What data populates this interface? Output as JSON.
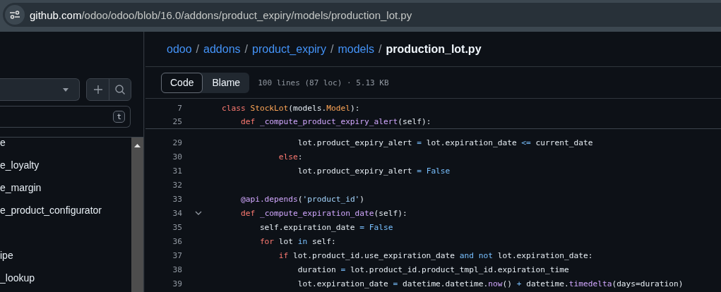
{
  "address_bar": {
    "host": "github.com",
    "path": "/odoo/odoo/blob/16.0/addons/product_expiry/models/production_lot.py"
  },
  "sidebar": {
    "filter_key": "t",
    "items": [
      {
        "label": "e"
      },
      {
        "label": "e_loyalty"
      },
      {
        "label": "e_margin"
      },
      {
        "label": "e_product_configurator"
      },
      {
        "label": "ipe",
        "gap_before": true
      },
      {
        "label": "_lookup"
      }
    ]
  },
  "breadcrumb": {
    "parts": [
      {
        "label": "odoo",
        "separator": "/"
      },
      {
        "label": "addons",
        "separator": "/"
      },
      {
        "label": "product_expiry",
        "separator": "/"
      },
      {
        "label": "models",
        "separator": "/"
      }
    ],
    "current": "production_lot.py"
  },
  "tabs": [
    {
      "label": "Code",
      "selected": true
    },
    {
      "label": "Blame",
      "selected": false
    }
  ],
  "file_info": "100 lines (87 loc) · 5.13 KB",
  "sticky_lines": [
    {
      "number": "7",
      "tokens": [
        {
          "kind": "kw",
          "text": "class"
        },
        {
          "kind": "cls",
          "text": " StockLot"
        },
        {
          "kind": "plain",
          "text": "(models."
        },
        {
          "kind": "cls",
          "text": "Model"
        },
        {
          "kind": "plain",
          "text": "):"
        }
      ]
    },
    {
      "number": "25",
      "tokens": [
        {
          "kind": "kw",
          "text": "    def"
        },
        {
          "kind": "fn",
          "text": " _compute_product_expiry_alert"
        },
        {
          "kind": "plain",
          "text": "(self):"
        }
      ]
    }
  ],
  "lines": [
    {
      "number": "29",
      "tokens": [
        {
          "kind": "plain",
          "text": "                lot.product_expiry_alert "
        },
        {
          "kind": "op",
          "text": "="
        },
        {
          "kind": "plain",
          "text": " lot.expiration_date "
        },
        {
          "kind": "op",
          "text": "<="
        },
        {
          "kind": "plain",
          "text": " current_date"
        }
      ]
    },
    {
      "number": "30",
      "tokens": [
        {
          "kind": "kw",
          "text": "            else"
        },
        {
          "kind": "plain",
          "text": ":"
        }
      ]
    },
    {
      "number": "31",
      "tokens": [
        {
          "kind": "plain",
          "text": "                lot.product_expiry_alert "
        },
        {
          "kind": "op",
          "text": "="
        },
        {
          "kind": "const",
          "text": " False"
        }
      ]
    },
    {
      "number": "32"
    },
    {
      "number": "33",
      "tokens": [
        {
          "kind": "fn",
          "text": "    @api.depends"
        },
        {
          "kind": "plain",
          "text": "("
        },
        {
          "kind": "str",
          "text": "'product_id'"
        },
        {
          "kind": "plain",
          "text": ")"
        }
      ]
    },
    {
      "number": "34",
      "fold_expanded": true,
      "tokens": [
        {
          "kind": "kw",
          "text": "    def"
        },
        {
          "kind": "fn",
          "text": " _compute_expiration_date"
        },
        {
          "kind": "plain",
          "text": "(self):"
        }
      ]
    },
    {
      "number": "35",
      "tokens": [
        {
          "kind": "plain",
          "text": "        self.expiration_date "
        },
        {
          "kind": "op",
          "text": "="
        },
        {
          "kind": "const",
          "text": " False"
        }
      ]
    },
    {
      "number": "36",
      "tokens": [
        {
          "kind": "kw",
          "text": "        for"
        },
        {
          "kind": "plain",
          "text": " lot "
        },
        {
          "kind": "op",
          "text": "in"
        },
        {
          "kind": "plain",
          "text": " self:"
        }
      ]
    },
    {
      "number": "37",
      "tokens": [
        {
          "kind": "kw",
          "text": "            if"
        },
        {
          "kind": "plain",
          "text": " lot.product_id.use_expiration_date "
        },
        {
          "kind": "op",
          "text": "and not"
        },
        {
          "kind": "plain",
          "text": " lot.expiration_date:"
        }
      ]
    },
    {
      "number": "38",
      "tokens": [
        {
          "kind": "plain",
          "text": "                duration "
        },
        {
          "kind": "op",
          "text": "="
        },
        {
          "kind": "plain",
          "text": " lot.product_id.product_tmpl_id.expiration_time"
        }
      ]
    },
    {
      "number": "39",
      "tokens": [
        {
          "kind": "plain",
          "text": "                lot.expiration_date "
        },
        {
          "kind": "op",
          "text": "="
        },
        {
          "kind": "plain",
          "text": " datetime.datetime."
        },
        {
          "kind": "fn",
          "text": "now"
        },
        {
          "kind": "plain",
          "text": "() "
        },
        {
          "kind": "op",
          "text": "+"
        },
        {
          "kind": "plain",
          "text": " datetime."
        },
        {
          "kind": "fn",
          "text": "timedelta"
        },
        {
          "kind": "plain",
          "text": "(days=duration)"
        }
      ]
    }
  ]
}
